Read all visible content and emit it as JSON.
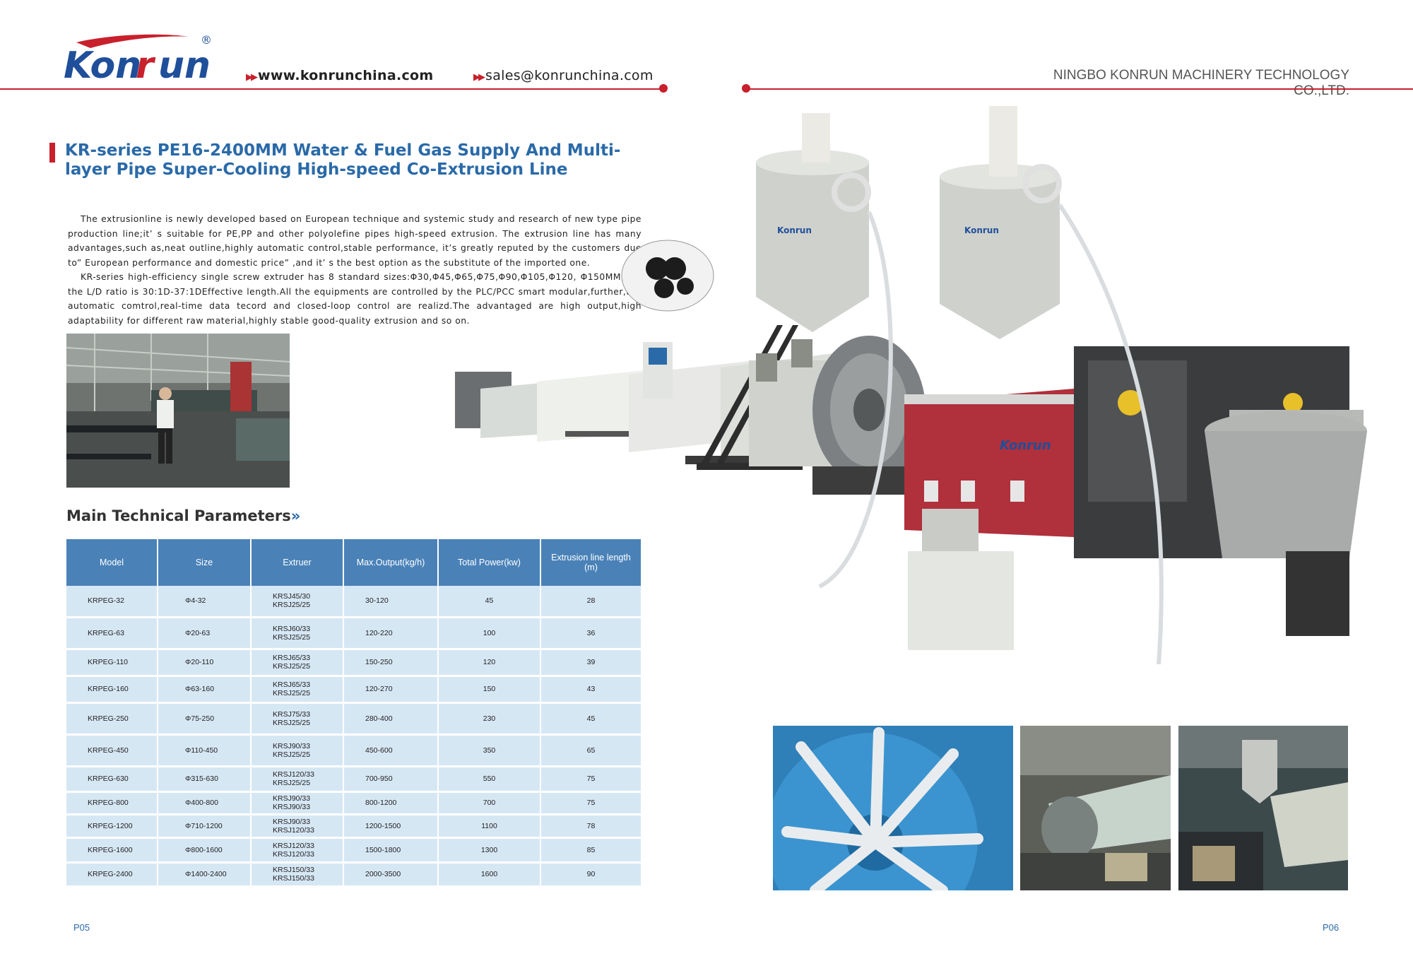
{
  "header": {
    "logo_text": "Konrun",
    "website": "www.konrunchina.com",
    "email": "sales@konrunchina.com",
    "company": "NINGBO KONRUN MACHINERY TECHNOLOGY CO.,LTD."
  },
  "title": "KR-series PE16-2400MM Water & Fuel Gas Supply And Multi-layer Pipe  Super-Cooling High-speed Co-Extrusion Line",
  "body": {
    "p1": "The extrusionline is newly developed based on European technique and systemic study and research of new type pipe production line;it’ s suitable for PE,PP and other polyolefine pipes high-speed extrusion. The extrusion line has many advantages,such as,neat outline,highly automatic control,stable performance, it’s greatly reputed by the customers due to” European performance and domestic price” ,and it’ s the best option as the substitute of the imported one.",
    "p2": "KR-series high-efficiency single screw extruder has 8 standard sizes:Φ30,Φ45,Φ65,Φ75,Φ90,Φ105,Φ120, Φ150MM,and the L/D ratio is 30:1D-37:1DEffective length.All the equipments are controlled by the PLC/PCC smart modular,further,the automatic comtrol,real-time data tecord and closed-loop control are realizd.The advantaged are high output,high adaptability for different raw material,highly stable good-quality extrusion and so on."
  },
  "params_heading": "Main Technical Parameters",
  "table": {
    "headers": [
      "Model",
      "Size",
      "Extruer",
      "Max.Output(kg/h)",
      "Total  Power(kw)",
      "Extrusion line length (m)"
    ],
    "rows": [
      {
        "model": "KRPEG-32",
        "size": "Φ4-32",
        "extruder1": "KRSJ45/30",
        "extruder2": "KRSJ25/25",
        "output": "30-120",
        "power": "45",
        "length": "28"
      },
      {
        "model": "KRPEG-63",
        "size": "Φ20-63",
        "extruder1": "KRSJ60/33",
        "extruder2": "KRSJ25/25",
        "output": "120-220",
        "power": "100",
        "length": "36"
      },
      {
        "model": "KRPEG-110",
        "size": "Φ20-110",
        "extruder1": "KRSJ65/33",
        "extruder2": "KRSJ25/25",
        "output": "150-250",
        "power": "120",
        "length": "39"
      },
      {
        "model": "KRPEG-160",
        "size": "Φ63-160",
        "extruder1": "KRSJ65/33",
        "extruder2": "KRSJ25/25",
        "output": "120-270",
        "power": "150",
        "length": "43"
      },
      {
        "model": "KRPEG-250",
        "size": "Φ75-250",
        "extruder1": "KRSJ75/33",
        "extruder2": "KRSJ25/25",
        "output": "280-400",
        "power": "230",
        "length": "45"
      },
      {
        "model": "KRPEG-450",
        "size": "Φ110-450",
        "extruder1": "KRSJ90/33",
        "extruder2": "KRSJ25/25",
        "output": "450-600",
        "power": "350",
        "length": "65"
      },
      {
        "model": "KRPEG-630",
        "size": "Φ315-630",
        "extruder1": "KRSJ120/33",
        "extruder2": "KRSJ25/25",
        "output": "700-950",
        "power": "550",
        "length": "75"
      },
      {
        "model": "KRPEG-800",
        "size": "Φ400-800",
        "extruder1": "KRSJ90/33",
        "extruder2": "KRSJ90/33",
        "output": "800-1200",
        "power": "700",
        "length": "75"
      },
      {
        "model": "KRPEG-1200",
        "size": "Φ710-1200",
        "extruder1": "KRSJ90/33",
        "extruder2": "KRSJ120/33",
        "output": "1200-1500",
        "power": "1100",
        "length": "78"
      },
      {
        "model": "KRPEG-1600",
        "size": "Φ800-1600",
        "extruder1": "KRSJ120/33",
        "extruder2": "KRSJ120/33",
        "output": "1500-1800",
        "power": "1300",
        "length": "85"
      },
      {
        "model": "KRPEG-2400",
        "size": "Φ1400-2400",
        "extruder1": "KRSJ150/33",
        "extruder2": "KRSJ150/33",
        "output": "2000-3500",
        "power": "1600",
        "length": "90"
      }
    ]
  },
  "pages": {
    "left": "P05",
    "right": "P06"
  },
  "colors": {
    "brand_red": "#c8202c",
    "brand_blue": "#2a6aa8",
    "table_header": "#4a82b8",
    "table_cell": "#d6e7f4"
  }
}
